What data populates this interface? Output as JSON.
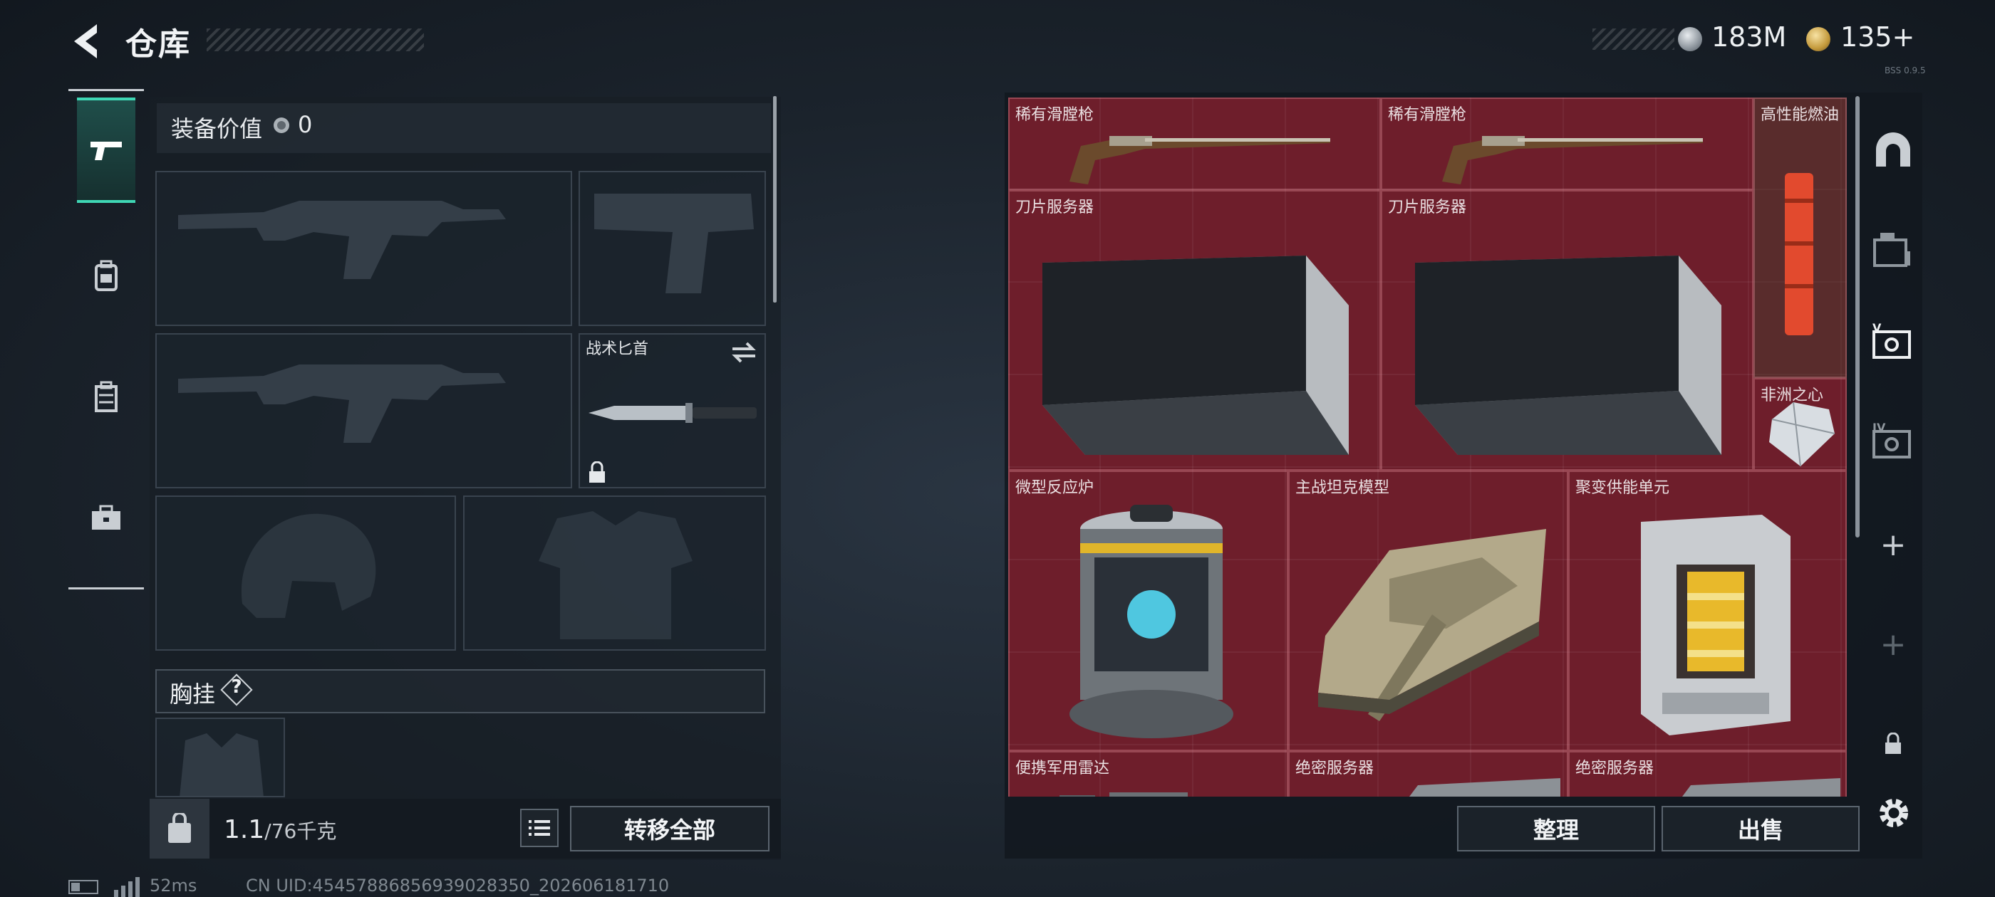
{
  "header": {
    "title": "仓库",
    "currencies": [
      {
        "icon": "silver-coin-icon",
        "value": "183M"
      },
      {
        "icon": "gold-coin-icon",
        "value": "135+"
      }
    ],
    "version_tag": "BSS 0.9.5"
  },
  "category_rail": [
    {
      "icon": "pistol-icon",
      "selected": true
    },
    {
      "icon": "backpack-icon",
      "selected": false
    },
    {
      "icon": "bag-icon",
      "selected": false
    },
    {
      "icon": "briefcase-icon",
      "selected": false
    }
  ],
  "equipment": {
    "value_label": "装备价值",
    "value": "0",
    "slots": {
      "primary_1": {
        "icon": "rifle-silhouette-icon",
        "label": ""
      },
      "pistol": {
        "icon": "pistol-silhouette-icon",
        "label": ""
      },
      "primary_2": {
        "icon": "rifle-silhouette-icon",
        "label": ""
      },
      "melee": {
        "label": "战术匕首",
        "icon": "knife-icon",
        "locked": true
      },
      "helmet": {
        "icon": "helmet-silhouette-icon",
        "label": ""
      },
      "armor": {
        "icon": "armor-silhouette-icon",
        "label": ""
      }
    },
    "chest_rig_label": "胸挂",
    "chest_rig_help": "?"
  },
  "bottom_bar": {
    "weight": "1.1",
    "weight_capacity": "/76千克",
    "transfer_all": "转移全部",
    "sort": "整理",
    "sell": "出售"
  },
  "stash_items": [
    {
      "name": "稀有滑膛枪",
      "icon": "musket-icon"
    },
    {
      "name": "稀有滑膛枪",
      "icon": "musket-icon"
    },
    {
      "name": "高性能燃油",
      "icon": "fuel-canister-icon"
    },
    {
      "name": "刀片服务器",
      "icon": "blade-server-icon"
    },
    {
      "name": "刀片服务器",
      "icon": "blade-server-icon"
    },
    {
      "name": "非洲之心",
      "icon": "diamond-icon"
    },
    {
      "name": "微型反应炉",
      "icon": "reactor-icon"
    },
    {
      "name": "主战坦克模型",
      "icon": "tank-icon"
    },
    {
      "name": "聚变供能单元",
      "icon": "power-cell-icon"
    },
    {
      "name": "便携军用雷达",
      "icon": "radar-icon"
    },
    {
      "name": "绝密服务器",
      "icon": "server-icon"
    },
    {
      "name": "绝密服务器",
      "icon": "server-icon"
    }
  ],
  "right_rail": [
    {
      "icon": "arch-icon",
      "label": ""
    },
    {
      "icon": "storage-box-icon",
      "label": ""
    },
    {
      "icon": "container-v-icon",
      "label": "V"
    },
    {
      "icon": "container-iv-icon",
      "label": "IV"
    },
    {
      "icon": "plus-icon",
      "label": "+"
    },
    {
      "icon": "plus-icon",
      "label": "+"
    },
    {
      "icon": "lock-icon",
      "label": ""
    },
    {
      "icon": "gear-icon",
      "label": ""
    }
  ],
  "status": {
    "ping": "52ms",
    "uid": "CN UID:45457886856939028350_202606181710"
  },
  "colors": {
    "accent": "#3fd6b4",
    "stash_bg": "#6b1f2a",
    "panel_bg": "#171e26"
  }
}
